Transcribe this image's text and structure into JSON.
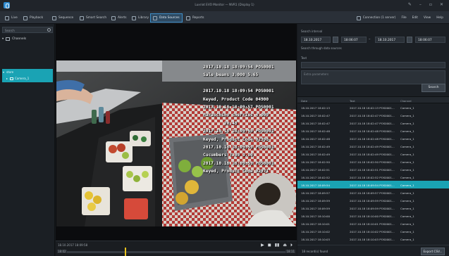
{
  "window": {
    "title": "Luxriot EVO Monitor — NVR1 (Display 1)"
  },
  "menu": {
    "items": [
      {
        "label": "Live",
        "icon": "live-icon"
      },
      {
        "label": "Playback",
        "icon": "playback-icon"
      },
      {
        "label": "Sequence",
        "icon": "sequence-icon"
      },
      {
        "label": "Smart Search",
        "icon": "smart-search-icon"
      },
      {
        "label": "Alerts",
        "icon": "bell-icon"
      },
      {
        "label": "Library",
        "icon": "library-icon"
      },
      {
        "label": "Data Sources",
        "icon": "data-sources-icon",
        "active": true
      },
      {
        "label": "Reports",
        "icon": "reports-icon"
      }
    ],
    "right": {
      "connection": "Connection (1 server)",
      "items": [
        "File",
        "Edit",
        "View",
        "Help"
      ]
    }
  },
  "sidebar": {
    "search_placeholder": "Search",
    "tree_header": "Channels",
    "tree": [
      {
        "label": "store",
        "level": 0
      },
      {
        "label": "Camera_1",
        "level": 1
      }
    ]
  },
  "video": {
    "overlay_lines": [
      "2017.10.18 18:09:54 POS0001",
      "Sale beans 3.000 5.65",
      "",
      "2017.10.18 18:09:54 POS0001",
      "Keyed, Product Code 04900",
      "2017.10.18 18:09:57 POS0001",
      "Maraschino cherries 4.000",
      "        20.48",
      "2017.10.18 18:09:59 POS0001",
      "Keyed, Product Code 02398",
      "2017.10.18 18:09:59 POS0001",
      "Cucumbers 7.09 0.00",
      "2017.10.18 18:09:59 POS0001",
      "Keyed, Product Code 02971"
    ]
  },
  "playback": {
    "time_label": "18.10.2017  18:09:58",
    "controls": [
      "▶",
      "◼",
      "▮▮",
      "⏏",
      "⏵"
    ],
    "range_start": "18:02",
    "range_end": "18:11",
    "position": 0.27
  },
  "search_panel": {
    "interval_label": "Search interval",
    "from_date": "18.10.2017",
    "from_time": "18:06:07",
    "to_date": "18.10.2017",
    "to_time": "18:06:07",
    "hint": "Search through data sources",
    "text_label": "Text",
    "text_placeholder": "",
    "extra_placeholder": "Extra parameters",
    "search_button": "Search"
  },
  "results": {
    "columns": [
      "Date",
      "Text",
      "Channel"
    ],
    "rows": [
      [
        "18.10.2017  18:02:13",
        "2017.10.18 18:02:13 POS0001...",
        "Camera_1"
      ],
      [
        "18.10.2017  18:02:47",
        "2017.10.18 18:02:47 POS0001...",
        "Camera_1"
      ],
      [
        "18.10.2017  18:02:47",
        "2017.10.18 18:02:47 POS0001...",
        "Camera_1"
      ],
      [
        "18.10.2017  18:02:48",
        "2017.10.18 18:02:48 POS0001...",
        "Camera_1"
      ],
      [
        "18.10.2017  18:02:48",
        "2017.10.18 18:02:48 POS0001...",
        "Camera_1"
      ],
      [
        "18.10.2017  18:02:49",
        "2017.10.18 18:02:49 POS0001...",
        "Camera_1"
      ],
      [
        "18.10.2017  18:02:49",
        "2017.10.18 18:02:49 POS0001...",
        "Camera_1"
      ],
      [
        "18.10.2017  18:02:50",
        "2017.10.18 18:02:50 POS0001...",
        "Camera_1"
      ],
      [
        "18.10.2017  18:02:51",
        "2017.10.18 18:02:51 POS0001...",
        "Camera_1"
      ],
      [
        "18.10.2017  18:02:52",
        "2017.10.18 18:02:52 POS0001...",
        "Camera_1"
      ],
      [
        "18.10.2017  18:09:54",
        "2017.10.18 18:09:54 POS0001...",
        "Camera_1"
      ],
      [
        "18.10.2017  18:09:57",
        "2017.10.18 18:09:57 POS0001...",
        "Camera_1"
      ],
      [
        "18.10.2017  18:09:59",
        "2017.10.18 18:09:59 POS0001...",
        "Camera_1"
      ],
      [
        "18.10.2017  18:09:59",
        "2017.10.18 18:09:59 POS0001...",
        "Camera_1"
      ],
      [
        "18.10.2017  18:10:00",
        "2017.10.18 18:10:00 POS0001...",
        "Camera_1"
      ],
      [
        "18.10.2017  18:10:01",
        "2017.10.18 18:10:01 POS0001...",
        "Camera_1"
      ],
      [
        "18.10.2017  18:10:02",
        "2017.10.18 18:10:02 POS0001...",
        "Camera_1"
      ],
      [
        "18.10.2017  18:10:03",
        "2017.10.18 18:10:03 POS0001...",
        "Camera_1"
      ]
    ],
    "selected_index": 10,
    "found_text": "18 record(s) found",
    "export_button": "Export CSV..."
  }
}
